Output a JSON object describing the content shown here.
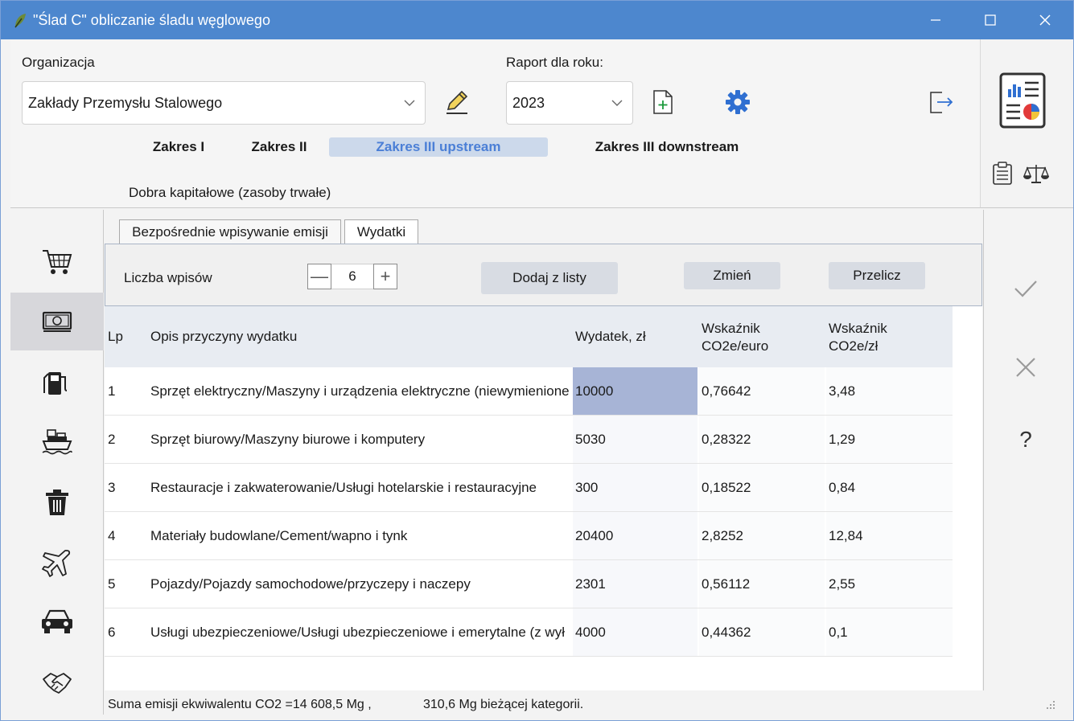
{
  "window": {
    "title": "\"Ślad C\" obliczanie śladu węglowego"
  },
  "header": {
    "organization_label": "Organizacja",
    "organization_value": "Zakłady  Przemysłu Stalowego",
    "year_label": "Raport dla roku:",
    "year_value": "2023"
  },
  "scopes": [
    {
      "label": "Zakres I"
    },
    {
      "label": "Zakres  II"
    },
    {
      "label": "Zakres III upstream"
    },
    {
      "label": "Zakres III downstream"
    }
  ],
  "category_title": "Dobra kapitałowe (zasoby trwałe)",
  "tabs": [
    {
      "label": "Bezpośrednie wpisywanie emisji"
    },
    {
      "label": "Wydatki"
    }
  ],
  "toolbar": {
    "entries_label": "Liczba wpisów",
    "entries_value": "6",
    "minus": "—",
    "plus": "+",
    "add_from_list": "Dodaj z listy",
    "change": "Zmień",
    "recalc": "Przelicz"
  },
  "table": {
    "headers": {
      "lp": "Lp",
      "desc": "Opis przyczyny wydatku",
      "expense": "Wydatek, zł",
      "factor_euro_1": "Wskaźnik",
      "factor_euro_2": "CO2e/euro",
      "factor_pln_1": "Wskaźnik",
      "factor_pln_2": "CO2e/zł"
    },
    "rows": [
      {
        "lp": "1",
        "desc": "Sprzęt elektryczny/Maszyny i urządzenia elektryczne (niewymienione",
        "expense": "10000",
        "factor_euro": "0,76642",
        "factor_pln": "3,48"
      },
      {
        "lp": "2",
        "desc": "Sprzęt biurowy/Maszyny biurowe i komputery",
        "expense": "5030",
        "factor_euro": "0,28322",
        "factor_pln": "1,29"
      },
      {
        "lp": "3",
        "desc": "Restauracje i zakwaterowanie/Usługi hotelarskie i restauracyjne",
        "expense": "300",
        "factor_euro": "0,18522",
        "factor_pln": "0,84"
      },
      {
        "lp": "4",
        "desc": "Materiały budowlane/Cement/wapno i tynk",
        "expense": "20400",
        "factor_euro": "2,8252",
        "factor_pln": "12,84"
      },
      {
        "lp": "5",
        "desc": "Pojazdy/Pojazdy samochodowe/przyczepy i naczepy",
        "expense": "2301",
        "factor_euro": "0,56112",
        "factor_pln": "2,55"
      },
      {
        "lp": "6",
        "desc": "Usługi ubezpieczeniowe/Usługi ubezpieczeniowe i emerytalne (z wył",
        "expense": "4000",
        "factor_euro": "0,44362",
        "factor_pln": "0,1"
      }
    ]
  },
  "status": {
    "total": "Suma emisji ekwiwalentu CO2 =14 608,5 Mg ,",
    "current": "310,6 Mg bieżącej kategorii."
  },
  "right_panel": {
    "help": "?"
  },
  "colors": {
    "titlebar": "#4d87ce",
    "selected_cell": "#a7b4d6",
    "active_scope": "#ccd9eb",
    "accent_blue": "#2f6fd1"
  }
}
